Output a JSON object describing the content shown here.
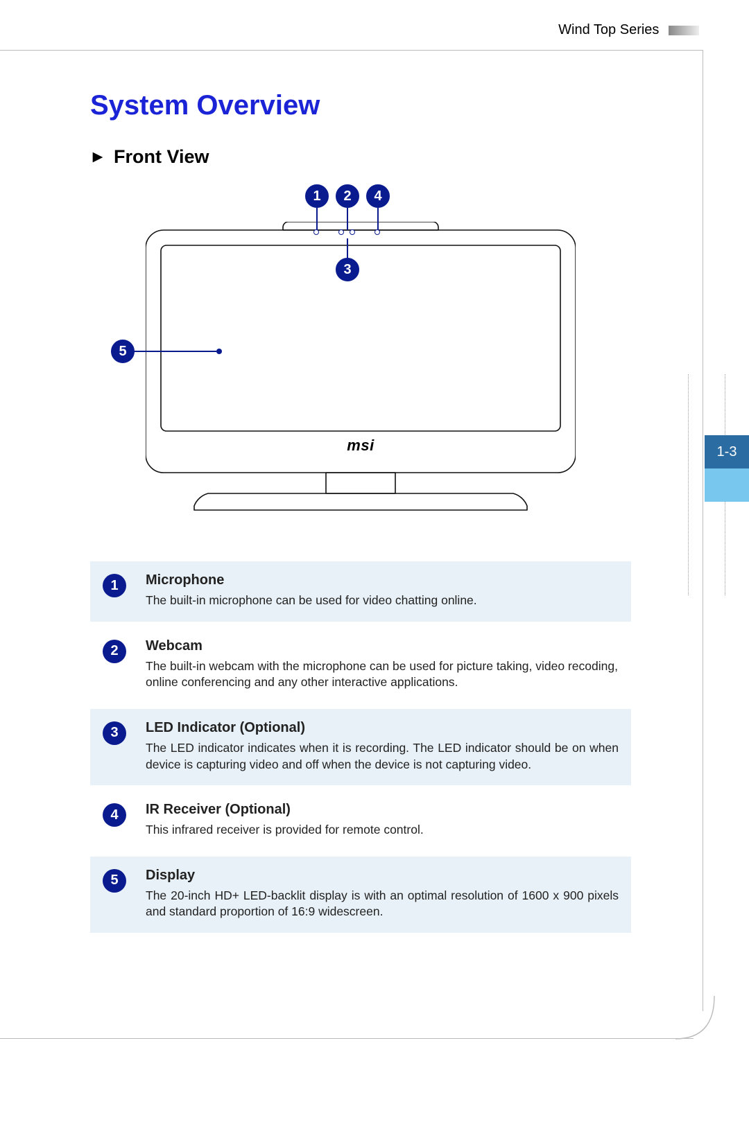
{
  "header": {
    "series_label": "Wind Top Series"
  },
  "page": {
    "section_number": "1-3"
  },
  "title": "System Overview",
  "subsection": {
    "heading": "Front View"
  },
  "figure": {
    "brand": "msi",
    "callouts_top": [
      "1",
      "2",
      "4"
    ],
    "callout_mid": "3",
    "callout_side": "5"
  },
  "items": [
    {
      "num": "1",
      "title": "Microphone",
      "desc": "The built-in microphone can be used for video chatting online."
    },
    {
      "num": "2",
      "title": "Webcam",
      "desc": "The built-in webcam with the microphone can be used for picture taking, video recoding, online conferencing and any other interactive applications."
    },
    {
      "num": "3",
      "title": "LED Indicator (Optional)",
      "desc": "The LED indicator indicates when it is recording. The LED indicator should be on when device is capturing video and off when the device is not capturing video."
    },
    {
      "num": "4",
      "title": "IR Receiver (Optional)",
      "desc": "This infrared receiver is provided for remote control."
    },
    {
      "num": "5",
      "title": "Display",
      "desc": "The 20-inch HD+ LED-backlit display is with an optimal resolution of 1600 x 900 pixels and standard proportion of 16:9 widescreen."
    }
  ]
}
